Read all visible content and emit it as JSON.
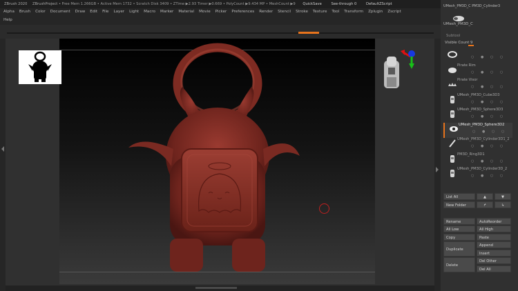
{
  "titlebar": {
    "app": "ZBrush 2020",
    "project": "ZBrushProject",
    "free_mem": "• Free Mem 1.266GB",
    "active_mem": "• Active Mem 1732",
    "scratch": "• Scratch Disk 3409",
    "ztime": "• ZTime ▶2.93 Timer ▶0.669",
    "polycount": "• PolyCount ▶9.434 MP",
    "meshcount": "• MeshCount ▶9",
    "quicksave": "QuickSave",
    "seethrough": "See-through  0",
    "defaultscript": "DefaultZScript"
  },
  "menu": {
    "row1": [
      "Alpha",
      "Brush",
      "Color",
      "Document",
      "Draw",
      "Edit",
      "File",
      "Layer",
      "Light",
      "Macro",
      "Marker",
      "Material",
      "Movie",
      "Picker",
      "Preferences",
      "Render",
      "Stencil",
      "Stroke",
      "Texture",
      "Tool",
      "Transform",
      "Zplugin",
      "Zscript"
    ],
    "row2": [
      "Help"
    ]
  },
  "panel": {
    "top_item_1": "UMesh_PM3D_C PM3D_Cylinder3",
    "top_item_2": "UMesh_PM3D_C",
    "subtool_header": "Subtool",
    "visible_count": "Visible Count 9",
    "subtools": [
      {
        "label": "",
        "icon": "ring-icon"
      },
      {
        "label": "Pirate Rim",
        "icon": "disc-icon"
      },
      {
        "label": "Pirate Visor",
        "icon": "visor-icon"
      },
      {
        "label": "UMesh_PM3D_Cube3D3",
        "icon": "figure-icon"
      },
      {
        "label": "UMesh_PM3D_Sphere3D3",
        "icon": "figure-icon"
      },
      {
        "label": "UMesh_PM3D_Sphere3D2",
        "icon": "eye-icon"
      },
      {
        "label": "UMesh_PM3D_Cylinder3D1_2",
        "icon": "pin-icon"
      },
      {
        "label": "PM3D_Ring3D1",
        "icon": "figure-icon"
      },
      {
        "label": "UMesh_PM3D_Cylinder3D_2",
        "icon": "figure-icon"
      }
    ],
    "list_all": "List All",
    "new_folder": "New Folder",
    "rename": "Rename",
    "autoreorder": "AutoReorder",
    "all_low": "All Low",
    "all_high": "All High",
    "copy": "Copy",
    "paste": "Paste",
    "duplicate": "Duplicate",
    "append": "Append",
    "insert": "Insert",
    "delete": "Delete",
    "del_other": "Del Other",
    "del_all": "Del All"
  },
  "colors": {
    "accent": "#e8741c",
    "model": "#7a2a22",
    "gizmo_red": "#e01010",
    "gizmo_green": "#18c018",
    "gizmo_blue": "#1838e0"
  }
}
